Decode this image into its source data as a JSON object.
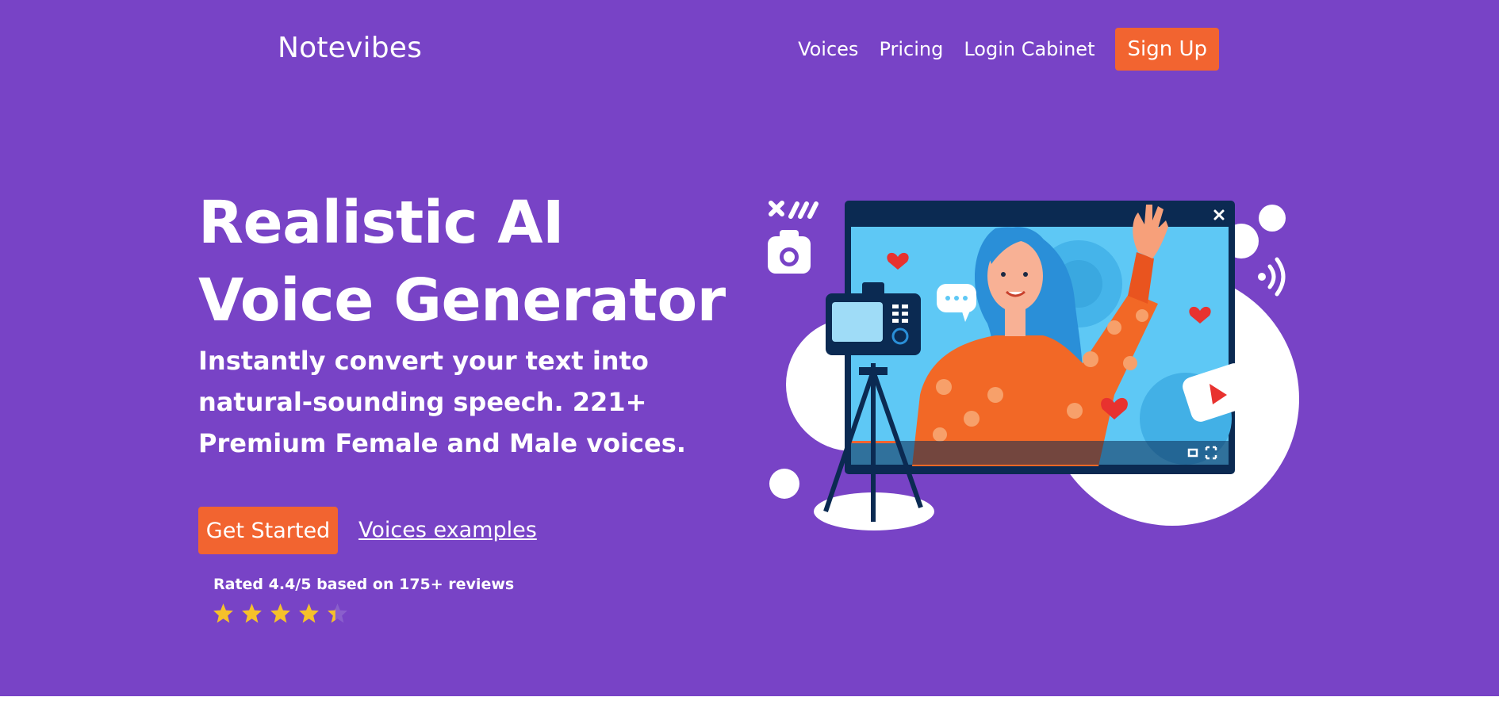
{
  "brand": {
    "name": "Notevibes"
  },
  "nav": {
    "items": [
      {
        "label": "Voices"
      },
      {
        "label": "Pricing"
      },
      {
        "label": "Login Cabinet"
      }
    ],
    "signup_label": "Sign Up"
  },
  "hero": {
    "title": "Realistic AI Voice Generator",
    "subtitle": "Instantly convert your text into natural-sounding speech. 221+ Premium Female and Male voices.",
    "cta_label": "Get Started",
    "examples_label": "Voices examples",
    "rating_text": "Rated 4.4/5 based on 175+ reviews",
    "rating_value": 4.4,
    "rating_max": 5
  },
  "colors": {
    "background": "#7843c6",
    "accent": "#f26430",
    "star": "#f6c12a"
  },
  "icons": [
    "camera-icon",
    "close-icon",
    "sound-waves-icon",
    "play-icon",
    "fullscreen-icon",
    "heart-icon",
    "chat-bubble-icon"
  ]
}
